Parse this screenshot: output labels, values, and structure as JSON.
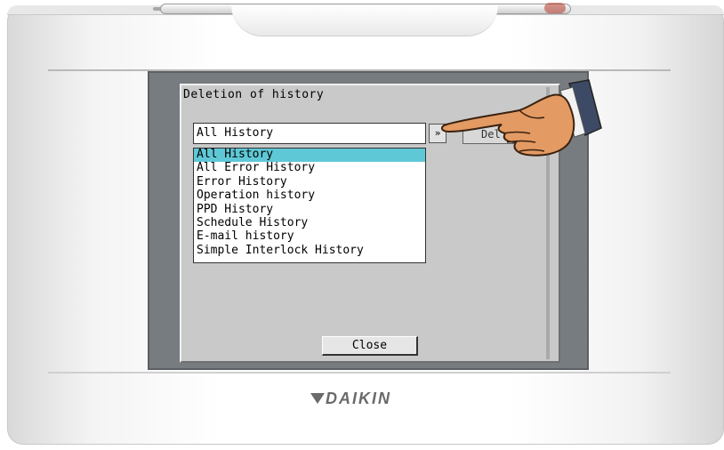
{
  "dialog": {
    "title": "Deletion of history",
    "combo_value": "All History",
    "combo_button_label": "»",
    "delete_button_label": "Del",
    "close_button_label": "Close"
  },
  "history_options": [
    {
      "label": "All History",
      "selected": true
    },
    {
      "label": "All Error History",
      "selected": false
    },
    {
      "label": "Error History",
      "selected": false
    },
    {
      "label": "Operation history",
      "selected": false
    },
    {
      "label": "PPD History",
      "selected": false
    },
    {
      "label": "Schedule History",
      "selected": false
    },
    {
      "label": "E-mail history",
      "selected": false
    },
    {
      "label": "Simple Interlock History",
      "selected": false
    }
  ],
  "device": {
    "brand": "DAIKIN"
  },
  "colors": {
    "selection": "#5fc8d6",
    "screen_background": "#c9c9c9",
    "frame": "#777c80"
  },
  "icons": {
    "pointer": "pointing-hand-icon",
    "brand_mark": "daikin-logo-mark"
  }
}
